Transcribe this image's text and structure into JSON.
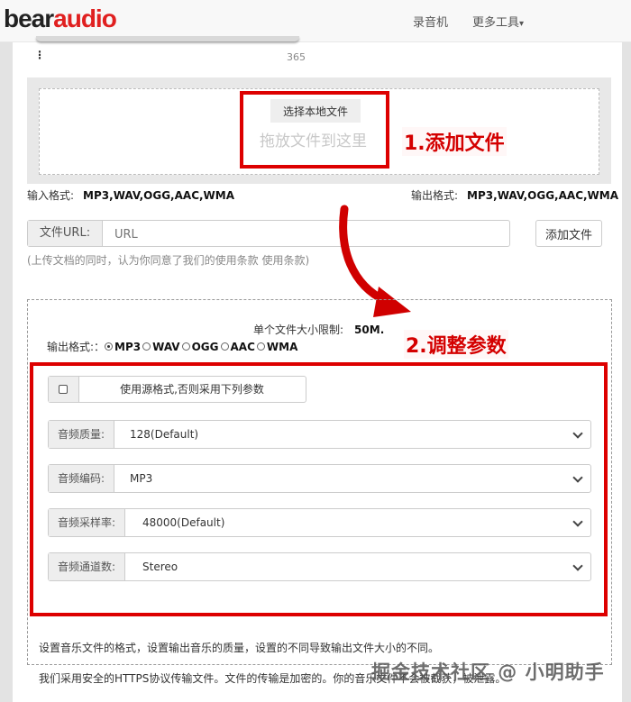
{
  "header": {
    "logo_part1": "bear",
    "logo_part2": "audio",
    "nav_recorder": "录音机",
    "nav_more_tools": "更多工具",
    "nav_more_caret": "▾"
  },
  "top_fragment": {
    "dots": "⋮",
    "count": "365"
  },
  "dropzone": {
    "choose_button": "选择本地文件",
    "hint": "拖放文件到这里",
    "annotation": "1.添加文件"
  },
  "formats": {
    "input_label": "输入格式:",
    "input_value": "MP3,WAV,OGG,AAC,WMA",
    "output_label": "输出格式:",
    "output_value": "MP3,WAV,OGG,AAC,WMA"
  },
  "url_row": {
    "label": "文件URL:",
    "placeholder": "URL",
    "add_button": "添加文件"
  },
  "terms_text": "(上传文档的同时，认为你同意了我们的使用条款 使用条款)",
  "settings": {
    "size_limit_label": "单个文件大小限制:",
    "size_limit_value": "50M.",
    "output_format_label": "输出格式:：",
    "radios": [
      {
        "label": "MP3",
        "selected": true
      },
      {
        "label": "WAV",
        "selected": false
      },
      {
        "label": "OGG",
        "selected": false
      },
      {
        "label": "AAC",
        "selected": false
      },
      {
        "label": "WMA",
        "selected": false
      }
    ],
    "annotation": "2.调整参数",
    "use_source_label": "使用源格式,否则采用下列参数",
    "quality": {
      "label": "音频质量:",
      "value": "128(Default)"
    },
    "codec": {
      "label": "音频编码:",
      "value": "MP3"
    },
    "sample_rate": {
      "label": "音频采样率:",
      "value": "48000(Default)"
    },
    "channels": {
      "label": "音频通道数:",
      "value": "Stereo"
    }
  },
  "description": {
    "line1": "设置音乐文件的格式，设置输出音乐的质量，设置的不同导致输出文件大小的不同。",
    "line2": "我们采用安全的HTTPS协议传输文件。文件的传输是加密的。你的音乐文件不会被截获，被泄露。"
  },
  "watermark": "掘金技术社区 @ 小明助手",
  "colors": {
    "brand_red": "#e02020",
    "annotation_red": "#dd0000"
  }
}
